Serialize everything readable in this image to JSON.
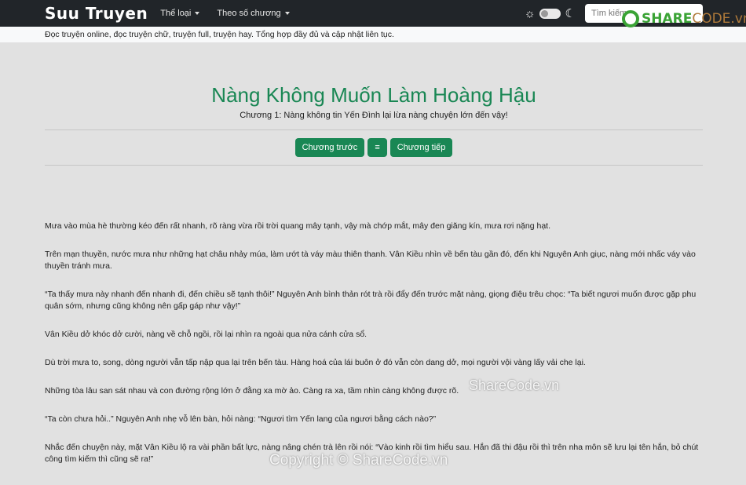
{
  "nav": {
    "brand": "Suu Truyen",
    "genre": "Thể loại",
    "by_chapter": "Theo số chương",
    "search_placeholder": "Tìm kiếm",
    "theme_icons": [
      "sun-icon",
      "moon-icon"
    ]
  },
  "tagline": "Đọc truyện online, đọc truyện chữ, truyện full, truyện hay. Tổng hợp đầy đủ và cập nhật liên tục.",
  "story": {
    "title": "Nàng Không Muốn Làm Hoàng Hậu",
    "chapter": "Chương 1: Nàng không tin Yến Đình lại lừa nàng chuyện lớn đến vậy!"
  },
  "buttons": {
    "prev": "Chương trước",
    "menu": "≡",
    "next": "Chương tiếp"
  },
  "paragraphs": [
    "Mưa vào mùa hè thường kéo đến rất nhanh, rõ ràng vừa rồi trời quang mây tạnh, vậy mà chớp mắt, mây đen giăng kín, mưa rơi nặng hạt.",
    "Trên mạn thuyền, nước mưa như những hạt châu nhảy múa, làm ướt tà váy màu thiên thanh. Vân Kiều nhìn về bến tàu gần đó, đến khi Nguyên Anh giục, nàng mới nhấc váy vào thuyền tránh mưa.",
    "“Ta thấy mưa này nhanh đến nhanh đi, đến chiều sẽ tạnh thôi!” Nguyên Anh bình thản rót trà rồi đẩy đến trước mặt nàng, giọng điệu trêu chọc: “Ta biết ngươi muốn được gặp phu quân sớm, nhưng cũng không nên gấp gáp như vậy!”",
    "Vân Kiều dở khóc dở cười, nàng về chỗ ngồi, rồi lại nhìn ra ngoài qua nửa cánh cửa sổ.",
    "Dù trời mưa to, song, dòng người vẫn tấp nập qua lại trên bến tàu. Hàng hoá của lái buôn ở đó vẫn còn dang dở, mọi người vội vàng lấy vải che lại.",
    "Những tòa lâu san sát nhau và con đường rộng lớn ở đằng xa mờ ảo. Càng ra xa, tầm nhìn càng không được rõ.",
    "“Ta còn chưa hỏi..” Nguyên Anh nhẹ vỗ lên bàn, hỏi nàng: “Ngươi tìm Yến lang của ngươi bằng cách nào?”",
    "Nhắc đến chuyện này, mặt Vân Kiều lộ ra vài phần bất lực, nàng nâng chén trà lên rồi nói: “Vào kinh rồi tìm hiểu sau. Hắn đã thi đậu rồi thì trên nha môn sẽ lưu lại tên hắn, bỏ chút công tìm kiếm thì cũng sẽ ra!”"
  ],
  "watermarks": {
    "logo_share": "SHARE",
    "logo_code": "CODE.vn",
    "center": "ShareCode.vn",
    "bottom": "Copyright © ShareCode.vn"
  },
  "colors": {
    "accent": "#198754",
    "navbar": "#212529"
  }
}
